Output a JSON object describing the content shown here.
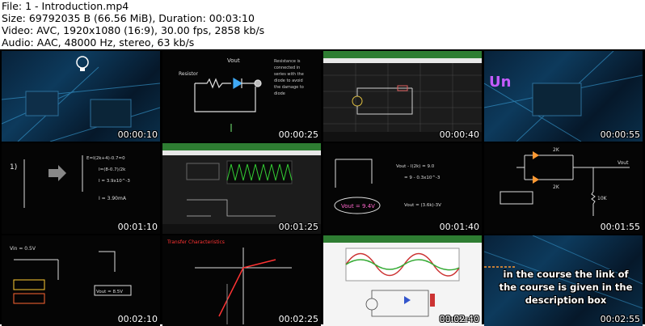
{
  "file_info": {
    "file": "File: 1 - Introduction.mp4",
    "size": "Size: 69792035 B (66.56 MiB), Duration: 00:03:10",
    "video": "Video: AVC, 1920x1080 (16:9), 30.00 fps, 2858 kb/s",
    "audio": "Audio: AAC, 48000 Hz, stereo, 63 kb/s"
  },
  "thumbnails": [
    {
      "time": "00:00:10"
    },
    {
      "time": "00:00:25",
      "notes": [
        "Resistor",
        "Vout",
        "Resistance is connected in series with the diode to avoid the damage to diode"
      ]
    },
    {
      "time": "00:00:40"
    },
    {
      "time": "00:00:55",
      "letter": "Un"
    },
    {
      "time": "00:01:10",
      "notes": [
        "I = 3.90mA"
      ]
    },
    {
      "time": "00:01:25"
    },
    {
      "time": "00:01:40",
      "notes": [
        "Vout = 9.4V"
      ]
    },
    {
      "time": "00:01:55",
      "notes": [
        "2K",
        "2K",
        "10K",
        "Vout"
      ]
    },
    {
      "time": "00:02:10",
      "notes": [
        "Vin = 0.5V",
        "Vout = 8.5V"
      ]
    },
    {
      "time": "00:02:25",
      "notes": [
        "Transfer Characteristics"
      ]
    },
    {
      "time": "00:02:40"
    },
    {
      "time": "00:02:55",
      "caption": [
        "in the course the link of",
        "the course is given in the",
        "description box"
      ]
    }
  ]
}
